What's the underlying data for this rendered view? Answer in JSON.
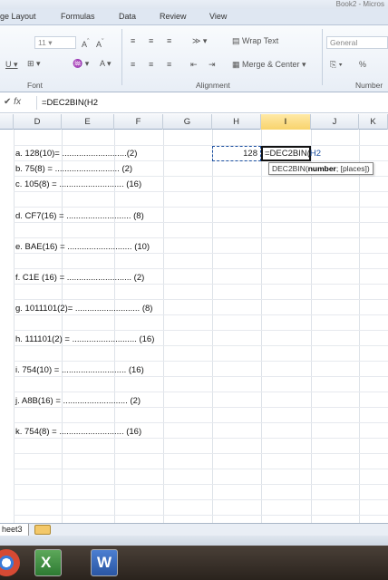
{
  "window": {
    "title_fragment": "Book2 - Micros"
  },
  "ribbon_tabs": [
    "ge Layout",
    "Formulas",
    "Data",
    "Review",
    "View"
  ],
  "ribbon": {
    "font_size": "11",
    "font_group_label": "Font",
    "alignment_group_label": "Alignment",
    "number_group_label": "Number",
    "wrap_text": "Wrap Text",
    "merge_center": "Merge & Center",
    "number_format": "General",
    "percent": "%"
  },
  "formula_bar": {
    "fx": "fx",
    "content": "=DEC2BIN(H2"
  },
  "columns": [
    "D",
    "E",
    "F",
    "G",
    "H",
    "I",
    "J",
    "K"
  ],
  "active_column": "I",
  "rows": [
    "a. 128(10)= ...........................(2)",
    "b. 75(8) = ........................... (2)",
    "c. 105(8) = ........................... (16)",
    "d. CF7(16) = ........................... (8)",
    "e. BAE(16) = ........................... (10)",
    "f. C1E (16) = ........................... (2)",
    "g. 1011101(2)= ........................... (8)",
    "h. 111101(2) = ........................... (16)",
    "i. 754(10) = ........................... (16)",
    "j. A8B(16) = ........................... (2)",
    "k. 754(8) = ........................... (16)"
  ],
  "cells": {
    "h2_value": "128",
    "i2_formula_prefix": "=DEC2BIN(",
    "i2_formula_ref": "H2"
  },
  "tooltip": {
    "func": "DEC2BIN(",
    "arg_bold": "number",
    "rest": "; [places])"
  },
  "sheet_tab": "heet3",
  "taskbar": {
    "excel_glyph": "X",
    "word_glyph": "W"
  },
  "colors": {
    "selection_border": "#1b4fa0",
    "active_col_header": "#f8d36c",
    "taskbar": "#2a231d"
  }
}
